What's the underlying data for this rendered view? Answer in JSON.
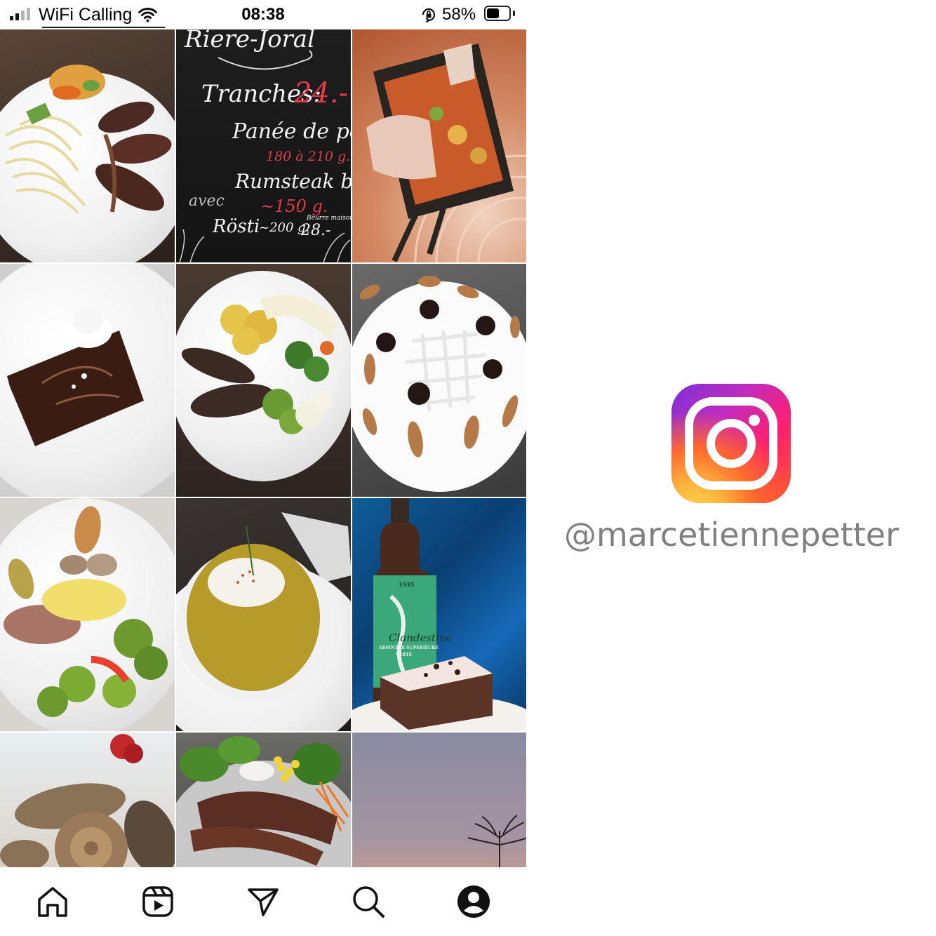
{
  "status_bar": {
    "carrier": "WiFi Calling",
    "time": "08:38",
    "battery_percent": "58%",
    "battery_level": 0.58,
    "signal_bars_filled": 2,
    "signal_bars_total": 4,
    "icons": [
      "signal-icon",
      "wifi-icon",
      "orientation-lock-icon",
      "battery-icon"
    ]
  },
  "grid": {
    "posts": [
      {
        "subject": "pasta-with-sausages"
      },
      {
        "subject": "chalkboard-menu",
        "lines": [
          "Riere-Joral",
          "Tranches:",
          "24.-",
          "Panée de porc",
          "180 à 210 g.",
          "Rumsteak boeuf",
          "avec",
          "~150 g.",
          "Beurre maison",
          "Rösti",
          "~200 g.",
          "28.-"
        ]
      },
      {
        "subject": "raclette-pan"
      },
      {
        "subject": "chocolate-cake-with-cream"
      },
      {
        "subject": "meat-rolls-with-vegetables"
      },
      {
        "subject": "cream-cake-with-chocolate-truffles"
      },
      {
        "subject": "roast-with-hasselback-potatoes"
      },
      {
        "subject": "soup-bowl"
      },
      {
        "subject": "absinthe-bottle-and-brownie",
        "label_lines": [
          "1935",
          "Clandestine",
          "ABSINTHE SUPÉRIEURE",
          "VERTE"
        ]
      },
      {
        "subject": "bread-loaves"
      },
      {
        "subject": "salad-with-bacon"
      },
      {
        "subject": "sunset-sky"
      }
    ]
  },
  "bottom_nav": {
    "items": [
      {
        "name": "home",
        "icon": "home-icon"
      },
      {
        "name": "reels",
        "icon": "reels-icon"
      },
      {
        "name": "direct",
        "icon": "send-icon"
      },
      {
        "name": "search",
        "icon": "search-icon"
      },
      {
        "name": "profile",
        "icon": "profile-icon"
      }
    ]
  },
  "branding": {
    "logo_icon": "instagram-logo-icon",
    "handle": "@marcetiennepetter",
    "handle_color": "#808080"
  },
  "colors": {
    "ig_gradient": [
      "#7a30d8",
      "#c32cbd",
      "#ff1f6c",
      "#ff5a2c",
      "#ffd34e"
    ],
    "chalk_accent": "#e13b4a"
  }
}
